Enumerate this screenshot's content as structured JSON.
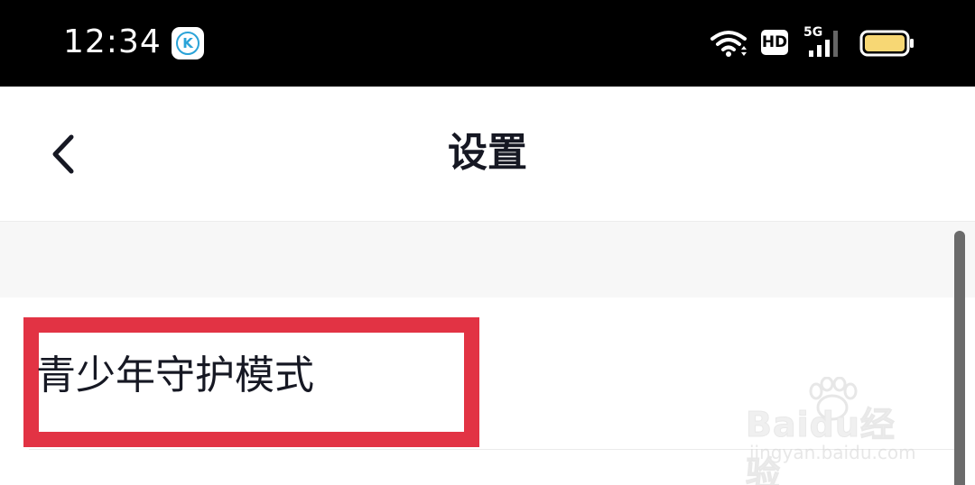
{
  "status_bar": {
    "time": "12:34",
    "app_badge_letter": "K",
    "hd_label": "HD",
    "network_label": "5G",
    "accent_color": "#2aa3d8",
    "battery_color": "#f7d774"
  },
  "nav_bar": {
    "back_icon": "chevron-left-icon",
    "title": "设置"
  },
  "settings": {
    "items": [
      {
        "label": "青少年守护模式",
        "highlighted": true,
        "highlight_color": "#e23344"
      }
    ]
  },
  "watermark": {
    "brand": "Baidu经验",
    "url": "jingyan.baidu.com"
  }
}
